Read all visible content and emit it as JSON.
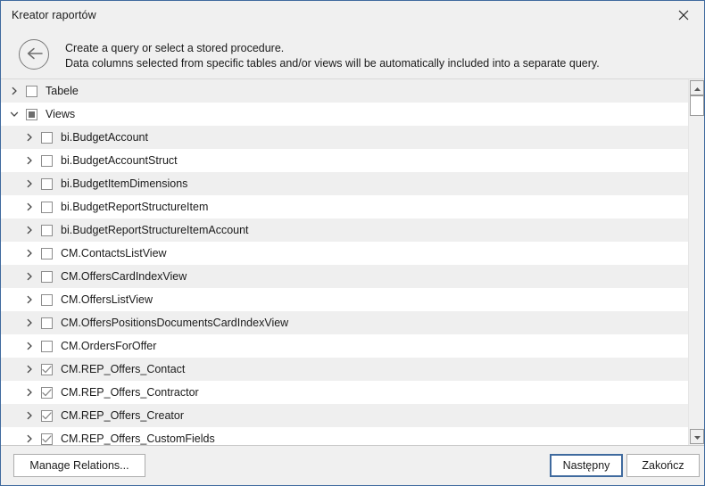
{
  "window": {
    "title": "Kreator raportów",
    "close_icon": "close-icon",
    "border_color": "#3f6a9e"
  },
  "header": {
    "back_icon": "back-arrow-icon",
    "line1": "Create a query or select a stored procedure.",
    "line2": "Data columns selected from specific tables and/or views will be automatically included into a separate query."
  },
  "tree": {
    "rows": [
      {
        "label": "Tabele",
        "level": 0,
        "expander": "chevron-right-icon",
        "check": "unchecked"
      },
      {
        "label": "Views",
        "level": 0,
        "expander": "chevron-down-icon",
        "check": "indeterminate"
      },
      {
        "label": "bi.BudgetAccount",
        "level": 1,
        "expander": "chevron-right-icon",
        "check": "unchecked"
      },
      {
        "label": "bi.BudgetAccountStruct",
        "level": 1,
        "expander": "chevron-right-icon",
        "check": "unchecked"
      },
      {
        "label": "bi.BudgetItemDimensions",
        "level": 1,
        "expander": "chevron-right-icon",
        "check": "unchecked"
      },
      {
        "label": "bi.BudgetReportStructureItem",
        "level": 1,
        "expander": "chevron-right-icon",
        "check": "unchecked"
      },
      {
        "label": "bi.BudgetReportStructureItemAccount",
        "level": 1,
        "expander": "chevron-right-icon",
        "check": "unchecked"
      },
      {
        "label": "CM.ContactsListView",
        "level": 1,
        "expander": "chevron-right-icon",
        "check": "unchecked"
      },
      {
        "label": "CM.OffersCardIndexView",
        "level": 1,
        "expander": "chevron-right-icon",
        "check": "unchecked"
      },
      {
        "label": "CM.OffersListView",
        "level": 1,
        "expander": "chevron-right-icon",
        "check": "unchecked"
      },
      {
        "label": "CM.OffersPositionsDocumentsCardIndexView",
        "level": 1,
        "expander": "chevron-right-icon",
        "check": "unchecked"
      },
      {
        "label": "CM.OrdersForOffer",
        "level": 1,
        "expander": "chevron-right-icon",
        "check": "unchecked"
      },
      {
        "label": "CM.REP_Offers_Contact",
        "level": 1,
        "expander": "chevron-right-icon",
        "check": "checked"
      },
      {
        "label": "CM.REP_Offers_Contractor",
        "level": 1,
        "expander": "chevron-right-icon",
        "check": "checked"
      },
      {
        "label": "CM.REP_Offers_Creator",
        "level": 1,
        "expander": "chevron-right-icon",
        "check": "checked"
      },
      {
        "label": "CM.REP_Offers_CustomFields",
        "level": 1,
        "expander": "chevron-right-icon",
        "check": "checked"
      }
    ]
  },
  "scrollbar": {
    "up_icon": "scroll-up-arrow-icon",
    "down_icon": "scroll-down-arrow-icon",
    "thumb": "scroll-thumb"
  },
  "footer": {
    "manage_relations": "Manage Relations...",
    "next": "Następny",
    "finish": "Zakończ",
    "default_button_color": "#3f6a9e"
  }
}
